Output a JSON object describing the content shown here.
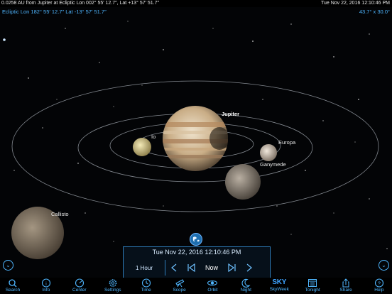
{
  "status_bar": {
    "distance_text": "0.0258 AU from Jupiter at Ecliptic Lon 002° 55′ 12.7″, Lat +13° 57′ 51.7″",
    "datetime_text": "Tue Nov 22, 2016   12:10:46 PM"
  },
  "view": {
    "ecliptic_coords": "Ecliptic Lon 182° 55′ 12.7″ Lat -13° 57′ 51.7″",
    "field_of_view": "43.7° x 30.0°"
  },
  "objects": {
    "jupiter": "Jupiter",
    "io": "Io",
    "europa": "Europa",
    "ganymede": "Ganymede",
    "callisto": "Callisto"
  },
  "time_panel": {
    "datetime": "Tue Nov 22, 2016    12:10:46 PM",
    "step": "1 Hour",
    "now": "Now"
  },
  "toolbar": [
    {
      "label": "Search",
      "icon": "search-icon"
    },
    {
      "label": "Info",
      "icon": "info-icon"
    },
    {
      "label": "Center",
      "icon": "center-icon"
    },
    {
      "label": "Settings",
      "icon": "settings-icon"
    },
    {
      "label": "Time",
      "icon": "clock-icon"
    },
    {
      "label": "Scope",
      "icon": "telescope-icon"
    },
    {
      "label": "Orbit",
      "icon": "orbit-icon"
    },
    {
      "label": "Night",
      "icon": "moon-icon"
    },
    {
      "label": "SkyWeek",
      "icon": "sky-logo"
    },
    {
      "label": "Tonight",
      "icon": "calendar-icon"
    },
    {
      "label": "Share",
      "icon": "share-icon"
    },
    {
      "label": "Help",
      "icon": "help-icon"
    }
  ],
  "colors": {
    "accent": "#4fb6ff",
    "panel_border": "#2f7ebd"
  }
}
